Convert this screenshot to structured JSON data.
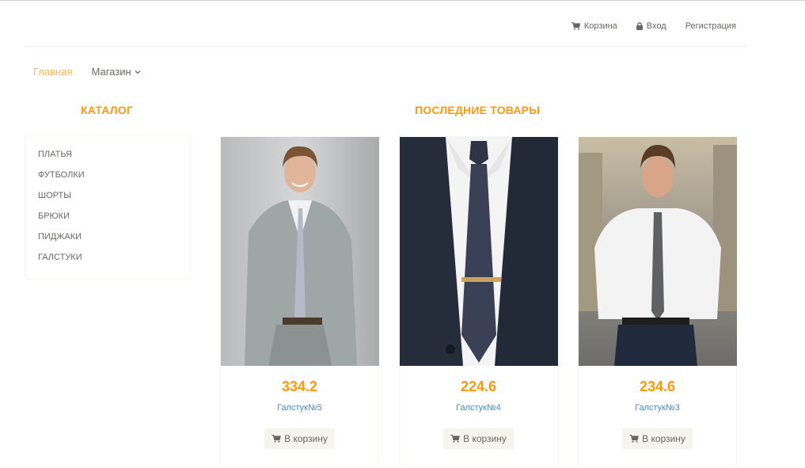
{
  "header": {
    "links": [
      {
        "label": "Корзина",
        "icon": "shopping-cart-icon"
      },
      {
        "label": "Вход",
        "icon": "lock-icon"
      },
      {
        "label": "Регистрация",
        "icon": ""
      }
    ]
  },
  "nav": {
    "items": [
      {
        "label": "Главная",
        "active": true
      },
      {
        "label": "Магазин",
        "dropdown": true
      }
    ]
  },
  "catalog": {
    "title": "КАТАЛОГ",
    "items": [
      "ПЛАТЬЯ",
      "ФУТБОЛКИ",
      "ШОРТЫ",
      "БРЮКИ",
      "ПИДЖАКИ",
      "ГАЛСТУКИ"
    ]
  },
  "latest": {
    "title": "ПОСЛЕДНИЕ ТОВАРЫ",
    "products": [
      {
        "price": "334.2",
        "name": "Галстук№5",
        "button": "В корзину"
      },
      {
        "price": "224.6",
        "name": "Галстук№4",
        "button": "В корзину"
      },
      {
        "price": "234.6",
        "name": "Галстук№3",
        "button": "В корзину"
      }
    ]
  },
  "colors": {
    "accent": "#fe980f",
    "active_nav": "#fdb45e",
    "link": "#428bca",
    "text": "#696763"
  }
}
